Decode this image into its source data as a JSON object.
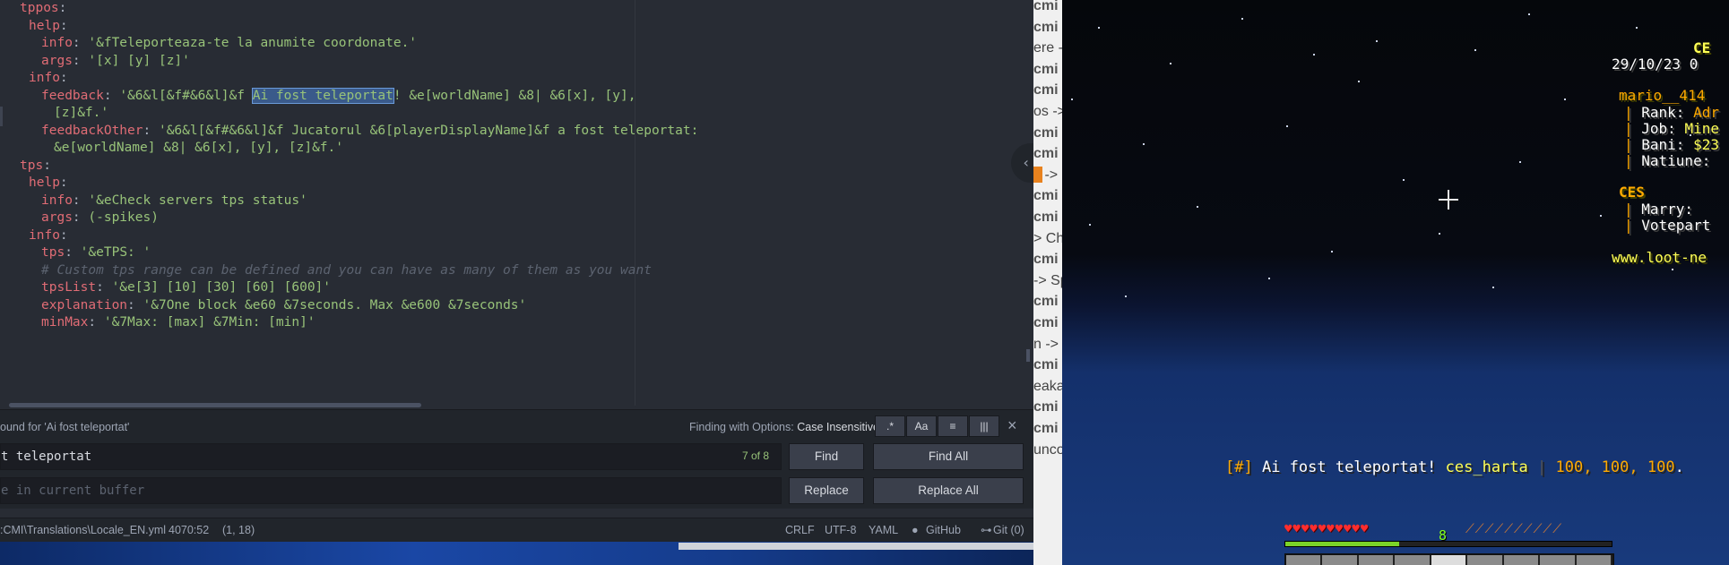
{
  "editor": {
    "lines": [
      {
        "indent": 1,
        "parts": [
          [
            "k",
            "tppos"
          ],
          [
            "p",
            ":"
          ]
        ]
      },
      {
        "indent": 2,
        "parts": [
          [
            "k",
            "help"
          ],
          [
            "p",
            ":"
          ]
        ]
      },
      {
        "indent": 3,
        "parts": [
          [
            "k",
            "info"
          ],
          [
            "p",
            ": "
          ],
          [
            "s",
            "'&fTeleporteaza-te la anumite coordonate.'"
          ]
        ]
      },
      {
        "indent": 3,
        "parts": [
          [
            "k",
            "args"
          ],
          [
            "p",
            ": "
          ],
          [
            "s",
            "'[x] [y] [z]'"
          ]
        ]
      },
      {
        "indent": 2,
        "parts": [
          [
            "k",
            "info"
          ],
          [
            "p",
            ":"
          ]
        ]
      },
      {
        "indent": 3,
        "parts": [
          [
            "k",
            "feedback"
          ],
          [
            "p",
            ": "
          ],
          [
            "s",
            "'&6&l[&f#&6&l]&f "
          ],
          [
            "hl",
            "Ai fost teleportat"
          ],
          [
            "s",
            "! &e[worldName] &8| &6[x], [y],"
          ]
        ]
      },
      {
        "indent": 4,
        "parts": [
          [
            "s",
            "[z]&f.'"
          ]
        ]
      },
      {
        "indent": 3,
        "parts": [
          [
            "k",
            "feedbackOther"
          ],
          [
            "p",
            ": "
          ],
          [
            "s",
            "'&6&l[&f#&6&l]&f Jucatorul &6[playerDisplayName]&f a fost teleportat:"
          ]
        ]
      },
      {
        "indent": 4,
        "parts": [
          [
            "s",
            "&e[worldName] &8| &6[x], [y], [z]&f.'"
          ]
        ]
      },
      {
        "indent": 1,
        "parts": [
          [
            "k",
            "tps"
          ],
          [
            "p",
            ":"
          ]
        ]
      },
      {
        "indent": 2,
        "parts": [
          [
            "k",
            "help"
          ],
          [
            "p",
            ":"
          ]
        ]
      },
      {
        "indent": 3,
        "parts": [
          [
            "k",
            "info"
          ],
          [
            "p",
            ": "
          ],
          [
            "s",
            "'&eCheck servers tps status'"
          ]
        ]
      },
      {
        "indent": 3,
        "parts": [
          [
            "k",
            "args"
          ],
          [
            "p",
            ": "
          ],
          [
            "s",
            "(-spikes)"
          ]
        ]
      },
      {
        "indent": 2,
        "parts": [
          [
            "k",
            "info"
          ],
          [
            "p",
            ":"
          ]
        ]
      },
      {
        "indent": 3,
        "parts": [
          [
            "k",
            "tps"
          ],
          [
            "p",
            ": "
          ],
          [
            "s",
            "'&eTPS: '"
          ]
        ]
      },
      {
        "indent": 3,
        "parts": [
          [
            "c",
            "# Custom tps range can be defined and you can have as many of them as you want"
          ]
        ]
      },
      {
        "indent": 3,
        "parts": [
          [
            "k",
            "tpsList"
          ],
          [
            "p",
            ": "
          ],
          [
            "s",
            "'&e[3] [10] [30] [60] [600]'"
          ]
        ]
      },
      {
        "indent": 3,
        "parts": [
          [
            "k",
            "explanation"
          ],
          [
            "p",
            ": "
          ],
          [
            "s",
            "'&7One block &e60 &7seconds. Max &e600 &7seconds'"
          ]
        ]
      },
      {
        "indent": 3,
        "parts": [
          [
            "k",
            "minMax"
          ],
          [
            "p",
            ": "
          ],
          [
            "s",
            "'&7Max: [max] &7Min: [min]'"
          ]
        ]
      }
    ]
  },
  "find": {
    "status": "ound for 'Ai fost teleportat'",
    "options_label": "Finding with Options:",
    "options_value": "Case Insensitive",
    "opt_regex": ".*",
    "opt_case": "Aa",
    "opt_selection": "≡",
    "opt_word": "|||",
    "close": "×",
    "find_value": "t teleportat",
    "count": "7 of 8",
    "replace_placeholder": "e in current buffer",
    "find_btn": "Find",
    "find_all_btn": "Find All",
    "replace_btn": "Replace",
    "replace_all_btn": "Replace All"
  },
  "status": {
    "path": ":CMI\\Translations\\Locale_EN.yml",
    "position": "4070:52",
    "selection": "(1, 18)",
    "line_ending": "CRLF",
    "encoding": "UTF-8",
    "grammar": "YAML",
    "github": "GitHub",
    "git": "Git (0)"
  },
  "console": {
    "lines": [
      "cmi",
      "cmi",
      "ere -",
      "cmi",
      "cmi",
      "os ->",
      "cmi",
      "cmi",
      "s ->",
      "cmi",
      "cmi",
      "> Ch",
      "cmi",
      "-> Sp",
      "cmi",
      "cmi",
      "n ->",
      "cmi",
      "eaka",
      "cmi",
      "cmi",
      "uncond"
    ]
  },
  "game": {
    "scoreboard": {
      "title": "CE",
      "date": "29/10/23 0",
      "player": "mario__414",
      "rank_label": "Rank: ",
      "rank_value": "Adr",
      "job_label": "Job: ",
      "job_value": "Mine",
      "bani_label": "Bani: ",
      "bani_value": "$23",
      "natiune_label": "Natiune:",
      "section2": "CES",
      "marry_label": "Marry:",
      "votepart_label": "Votepart",
      "url": "www.loot-ne"
    },
    "chat": {
      "prefix": "[#]",
      "message": " Ai fost teleportat! ",
      "world": "ces_harta",
      "sep": " | ",
      "coords": "100, 100, 100",
      "dot": "."
    },
    "level": "8",
    "hearts": "♥♥♥♥♥♥♥♥♥♥",
    "food": "⟋⟋⟋⟋⟋⟋⟋⟋⟋⟋",
    "xp_fraction": 0.35
  },
  "colors": {
    "editor_bg": "#282c34",
    "key": "#e06c75",
    "string": "#98c379",
    "comment": "#5c6370",
    "mc_gold": "#ffaa00",
    "mc_yellow": "#ffff55"
  }
}
